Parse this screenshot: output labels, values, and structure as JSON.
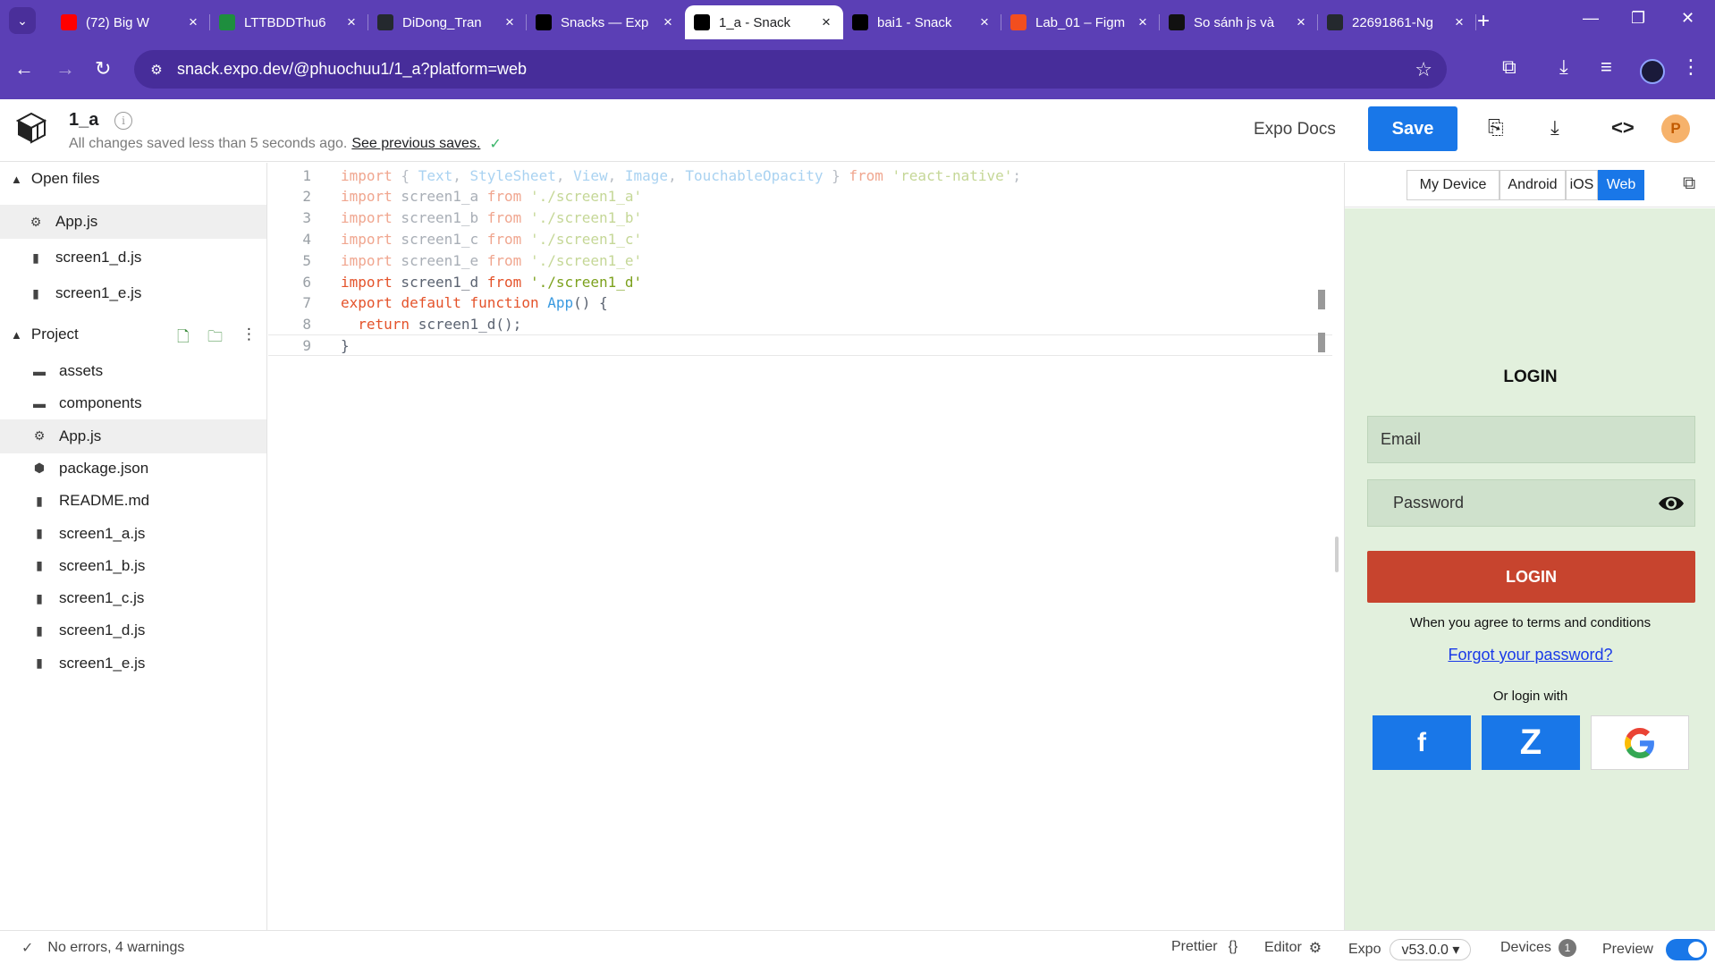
{
  "browser": {
    "tabs": [
      {
        "title": "(72) Big W",
        "favicon": "youtube-icon",
        "color": "#ff0000"
      },
      {
        "title": "LTTBDDThu6",
        "favicon": "sheets-icon",
        "color": "#1e8e3e"
      },
      {
        "title": "DiDong_Tran",
        "favicon": "github-icon",
        "color": "#24292e"
      },
      {
        "title": "Snacks — Exp",
        "favicon": "expo-icon",
        "color": "#000000"
      },
      {
        "title": "1_a - Snack",
        "favicon": "snack-icon",
        "color": "#000000"
      },
      {
        "title": "bai1 - Snack",
        "favicon": "snack-icon",
        "color": "#000000"
      },
      {
        "title": "Lab_01 – Figm",
        "favicon": "figma-icon",
        "color": "#f24e1e"
      },
      {
        "title": "So sánh js và",
        "favicon": "chatgpt-icon",
        "color": "#111111"
      },
      {
        "title": "22691861-Ng",
        "favicon": "github-icon",
        "color": "#24292e"
      }
    ],
    "url": "snack.expo.dev/@phuochuu1/1_a?platform=web",
    "theme_color": "#5b3fb5"
  },
  "header": {
    "project_name": "1_a",
    "saved_text": "All changes saved less than 5 seconds ago.",
    "previous_saves_link": "See previous saves.",
    "expo_docs": "Expo Docs",
    "save_label": "Save",
    "user_initial": "P"
  },
  "sidebar": {
    "open_files_label": "Open files",
    "open_files": [
      {
        "name": "App.js",
        "icon": "js-file-icon",
        "selected": true
      },
      {
        "name": "screen1_d.js",
        "icon": "file-icon",
        "selected": false
      },
      {
        "name": "screen1_e.js",
        "icon": "file-icon",
        "selected": false
      }
    ],
    "project_label": "Project",
    "project_files": [
      {
        "name": "assets",
        "icon": "folder-icon",
        "selected": false
      },
      {
        "name": "components",
        "icon": "folder-icon",
        "selected": false
      },
      {
        "name": "App.js",
        "icon": "js-file-icon",
        "selected": true
      },
      {
        "name": "package.json",
        "icon": "package-icon",
        "selected": false
      },
      {
        "name": "README.md",
        "icon": "file-icon",
        "selected": false
      },
      {
        "name": "screen1_a.js",
        "icon": "file-icon",
        "selected": false
      },
      {
        "name": "screen1_b.js",
        "icon": "file-icon",
        "selected": false
      },
      {
        "name": "screen1_c.js",
        "icon": "file-icon",
        "selected": false
      },
      {
        "name": "screen1_d.js",
        "icon": "file-icon",
        "selected": false
      },
      {
        "name": "screen1_e.js",
        "icon": "file-icon",
        "selected": false
      }
    ]
  },
  "editor": {
    "lines": [
      {
        "n": "1",
        "tokens": [
          [
            "kw dim",
            "import"
          ],
          [
            "pn dim",
            " { "
          ],
          [
            "ty dim",
            "Text"
          ],
          [
            "pn dim",
            ", "
          ],
          [
            "ty dim",
            "StyleSheet"
          ],
          [
            "pn dim",
            ", "
          ],
          [
            "ty dim",
            "View"
          ],
          [
            "pn dim",
            ", "
          ],
          [
            "ty dim",
            "Image"
          ],
          [
            "pn dim",
            ", "
          ],
          [
            "ty dim",
            "TouchableOpacity"
          ],
          [
            "pn dim",
            " } "
          ],
          [
            "kw dim",
            "from"
          ],
          [
            "pn dim",
            " "
          ],
          [
            "str dim",
            "'react-native'"
          ],
          [
            "pn dim",
            ";"
          ]
        ]
      },
      {
        "n": "2",
        "tokens": [
          [
            "kw dim",
            "import"
          ],
          [
            "id dim",
            " screen1_a "
          ],
          [
            "kw dim",
            "from"
          ],
          [
            "pn dim",
            " "
          ],
          [
            "str dim",
            "'./screen1_a'"
          ]
        ]
      },
      {
        "n": "3",
        "tokens": [
          [
            "kw dim",
            "import"
          ],
          [
            "id dim",
            " screen1_b "
          ],
          [
            "kw dim",
            "from"
          ],
          [
            "pn dim",
            " "
          ],
          [
            "str dim",
            "'./screen1_b'"
          ]
        ]
      },
      {
        "n": "4",
        "tokens": [
          [
            "kw dim",
            "import"
          ],
          [
            "id dim",
            " screen1_c "
          ],
          [
            "kw dim",
            "from"
          ],
          [
            "pn dim",
            " "
          ],
          [
            "str dim",
            "'./screen1_c'"
          ]
        ]
      },
      {
        "n": "5",
        "tokens": [
          [
            "kw dim",
            "import"
          ],
          [
            "id dim",
            " screen1_e "
          ],
          [
            "kw dim",
            "from"
          ],
          [
            "pn dim",
            " "
          ],
          [
            "str dim",
            "'./screen1_e'"
          ]
        ]
      },
      {
        "n": "6",
        "tokens": [
          [
            "kw",
            "import"
          ],
          [
            "id",
            " screen1_d "
          ],
          [
            "kw",
            "from"
          ],
          [
            "pn",
            " "
          ],
          [
            "str",
            "'./screen1_d'"
          ]
        ]
      },
      {
        "n": "7",
        "tokens": [
          [
            "kw",
            "export"
          ],
          [
            "pn",
            " "
          ],
          [
            "kw",
            "default"
          ],
          [
            "pn",
            " "
          ],
          [
            "kw",
            "function"
          ],
          [
            "pn",
            " "
          ],
          [
            "ty",
            "App"
          ],
          [
            "pn",
            "() {"
          ]
        ]
      },
      {
        "n": "8",
        "tokens": [
          [
            "pn",
            "  "
          ],
          [
            "kw",
            "return"
          ],
          [
            "id",
            " screen1_d"
          ],
          [
            "pn",
            "();"
          ]
        ]
      },
      {
        "n": "9",
        "tokens": [
          [
            "pn",
            "}"
          ]
        ]
      }
    ]
  },
  "preview": {
    "platforms": [
      "My Device",
      "Android",
      "iOS",
      "Web"
    ],
    "active_platform": "Web",
    "screen_bg": "#e2f0dd",
    "login_title": "LOGIN",
    "email_placeholder": "Email",
    "password_placeholder": "Password",
    "login_button": "LOGIN",
    "terms_text": "When you agree to terms and conditions",
    "forgot_link": "Forgot your password?",
    "or_login_with": "Or login with",
    "social": [
      {
        "label": "f",
        "icon": "facebook-icon"
      },
      {
        "label": "Z",
        "icon": "zalo-icon"
      },
      {
        "label": "",
        "icon": "google-icon"
      }
    ]
  },
  "statusbar": {
    "problems": "No errors, 4 warnings",
    "prettier": "Prettier",
    "prettier_icon": "{}",
    "editor": "Editor",
    "expo": "Expo",
    "sdk": "v53.0.0 ▾",
    "devices": "Devices",
    "devices_count": "1",
    "preview": "Preview"
  }
}
